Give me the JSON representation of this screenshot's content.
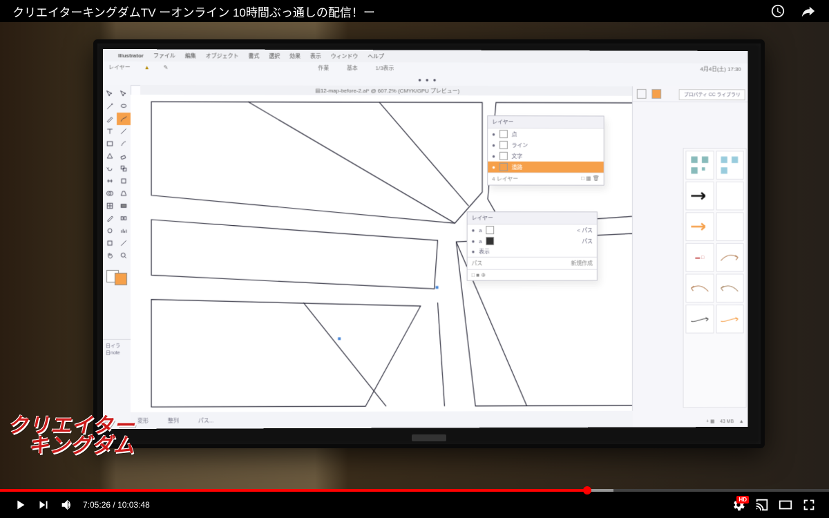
{
  "video": {
    "title": "クリエイターキングダムTV ーオンライン 10時間ぶっ通しの配信！ー",
    "current_time": "7:05:26",
    "duration": "10:03:48",
    "progress_pct": 70.8,
    "buffered_pct": 74
  },
  "overlay_logo": {
    "line1": "クリエイター",
    "line2": "キングダム"
  },
  "ai": {
    "app": "Illustrator",
    "menus": [
      "ファイル",
      "編集",
      "オブジェクト",
      "書式",
      "選択",
      "効果",
      "表示",
      "ウィンドウ",
      "ヘルプ"
    ],
    "clock": "4月4日(土) 17:30",
    "home_label": "レイヤー",
    "top_mid": [
      "作業",
      "基本",
      "1/3表示"
    ],
    "doc_tab": "12-map-before-2.ai* @ 607.2% (CMYK/GPU プレビュー)",
    "cc_button": "プロパティ  CC ライブラリ",
    "layers_panel": {
      "title": "レイヤー",
      "items": [
        {
          "label": "点"
        },
        {
          "label": "ライン"
        },
        {
          "label": "文字"
        },
        {
          "label": "道路",
          "selected": true
        }
      ],
      "footer": "4 レイヤー"
    },
    "layers_panel2": {
      "title": "レイヤー",
      "rows": [
        {
          "l": "a",
          "r": "< パス"
        },
        {
          "l": "a",
          "r": "パス"
        },
        {
          "l": "表示",
          "r": ""
        }
      ],
      "footer_l": "パス",
      "footer_r": "新規作成"
    },
    "left_panel_items": [
      "日イラ",
      "日note"
    ],
    "bottom_status": [
      "変形",
      "整列",
      "パス..."
    ],
    "right_status": "43 MB"
  }
}
